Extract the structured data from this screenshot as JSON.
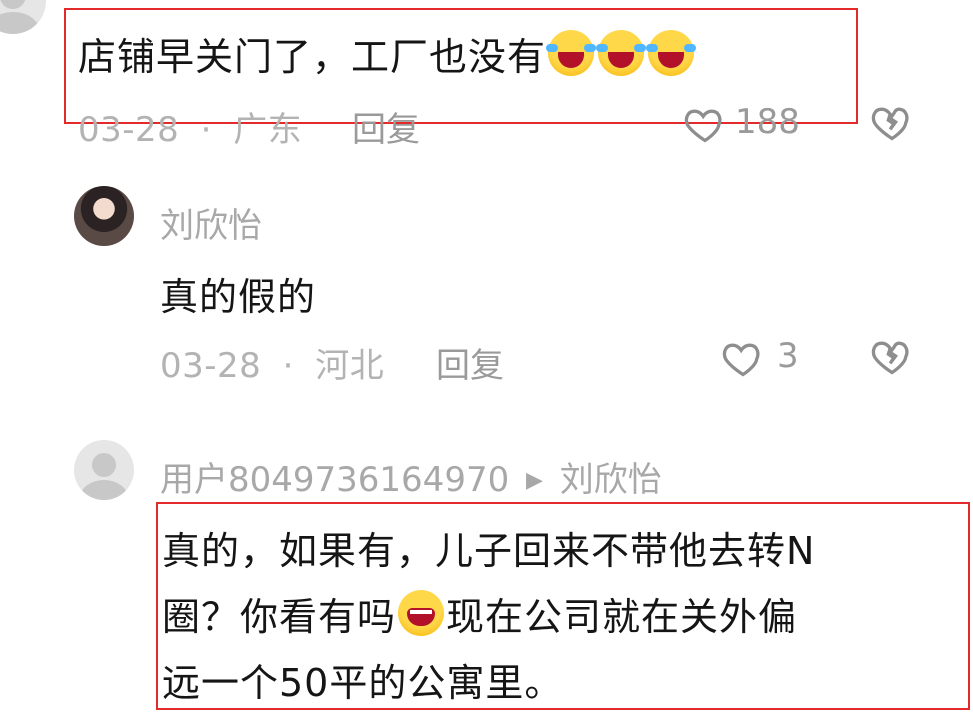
{
  "comments": [
    {
      "text_before_emoji": "店铺早关门了，工厂也没有",
      "emoji_count": 3,
      "date": "03-28",
      "location": "广东",
      "separator": "·",
      "reply_label": "回复",
      "likes": "188"
    },
    {
      "username": "刘欣怡",
      "text": "真的假的",
      "date": "03-28",
      "location": "河北",
      "separator": "·",
      "reply_label": "回复",
      "likes": "3"
    },
    {
      "username": "用户8049736164970",
      "arrow": "▶",
      "reply_to": "刘欣怡",
      "line1": "真的，如果有，儿子回来不带他去转N",
      "line2_before_emoji": "圈？你看有吗",
      "line2_after_emoji": "现在公司就在关外偏",
      "line3": "远一个50平的公寓里。"
    }
  ],
  "colors": {
    "highlight_box": "#e32a2a",
    "meta_text": "#b3b3b3",
    "body_text": "#151515"
  },
  "icons": [
    "heart-outline-icon",
    "broken-heart-icon",
    "crying-laughing-emoji",
    "laughing-emoji",
    "default-avatar-icon"
  ]
}
